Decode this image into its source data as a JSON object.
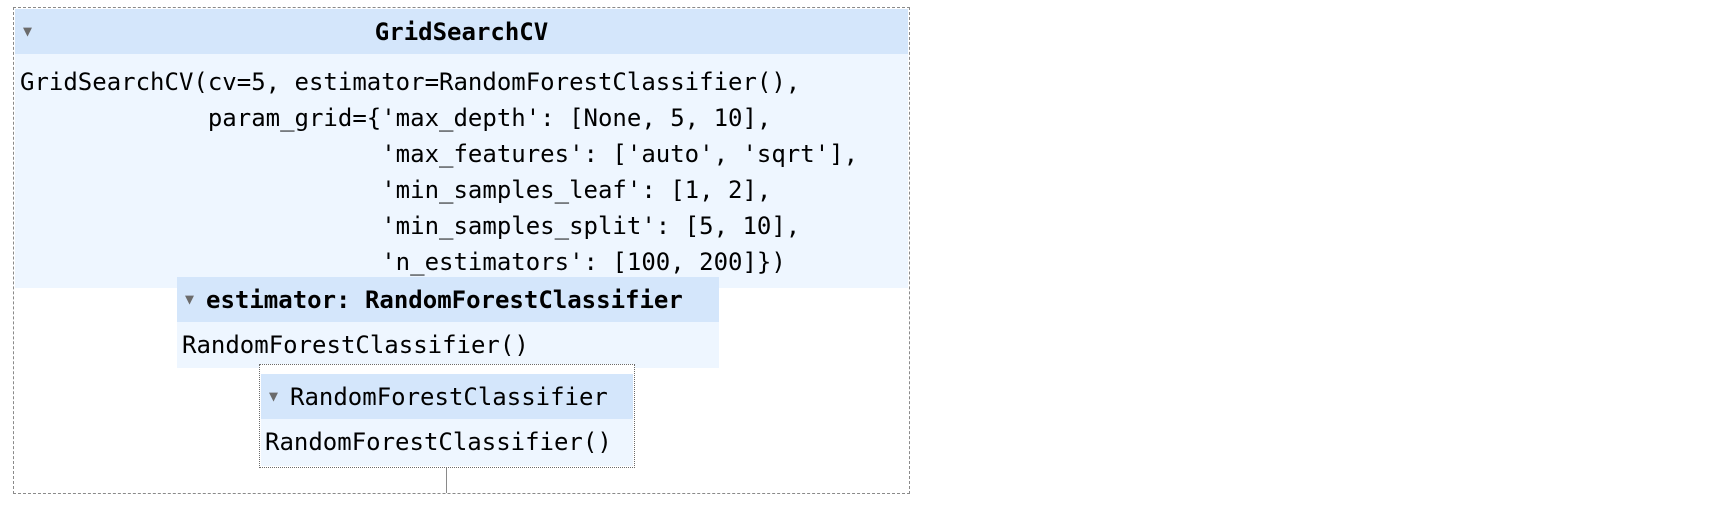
{
  "grid_search": {
    "title": "GridSearchCV",
    "params": "GridSearchCV(cv=5, estimator=RandomForestClassifier(),\n             param_grid={'max_depth': [None, 5, 10],\n                         'max_features': ['auto', 'sqrt'],\n                         'min_samples_leaf': [1, 2],\n                         'min_samples_split': [5, 10],\n                         'n_estimators': [100, 200]})",
    "caret": "▼"
  },
  "estimator": {
    "title": "estimator: RandomForestClassifier",
    "repr": "RandomForestClassifier()",
    "caret": "▼"
  },
  "leaf": {
    "title": "RandomForestClassifier",
    "repr": "RandomForestClassifier()",
    "caret": "▼"
  },
  "colors": {
    "header_bg": "#d4e6fb",
    "body_bg": "#eef6ff",
    "border": "#8a8a8a"
  },
  "icons": {
    "toggle": "caret-down-icon"
  }
}
